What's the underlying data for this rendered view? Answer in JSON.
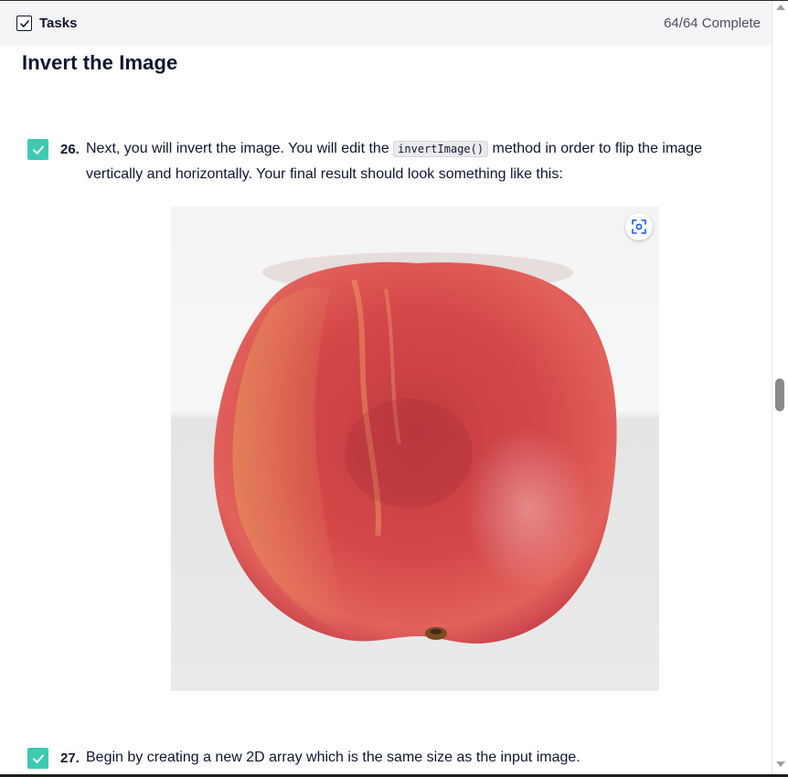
{
  "header": {
    "title": "Tasks",
    "status": "64/64 Complete"
  },
  "section": {
    "title": "Invert the Image"
  },
  "tasks": [
    {
      "number": "26.",
      "text_before": "Next, you will invert the image. You will edit the ",
      "code": "invertImage()",
      "text_after": " method in order to flip the image vertically and horizontally. Your final result should look something like this:",
      "completed": true
    },
    {
      "number": "27.",
      "text": "Begin by creating a new 2D array which is the same size as the input image.",
      "completed": true
    }
  ],
  "figure": {
    "zoom_icon": "zoom-icon"
  },
  "colors": {
    "accent_check": "#3dcab1",
    "header_bg": "#f5f5f7",
    "text_dark": "#10162f"
  }
}
